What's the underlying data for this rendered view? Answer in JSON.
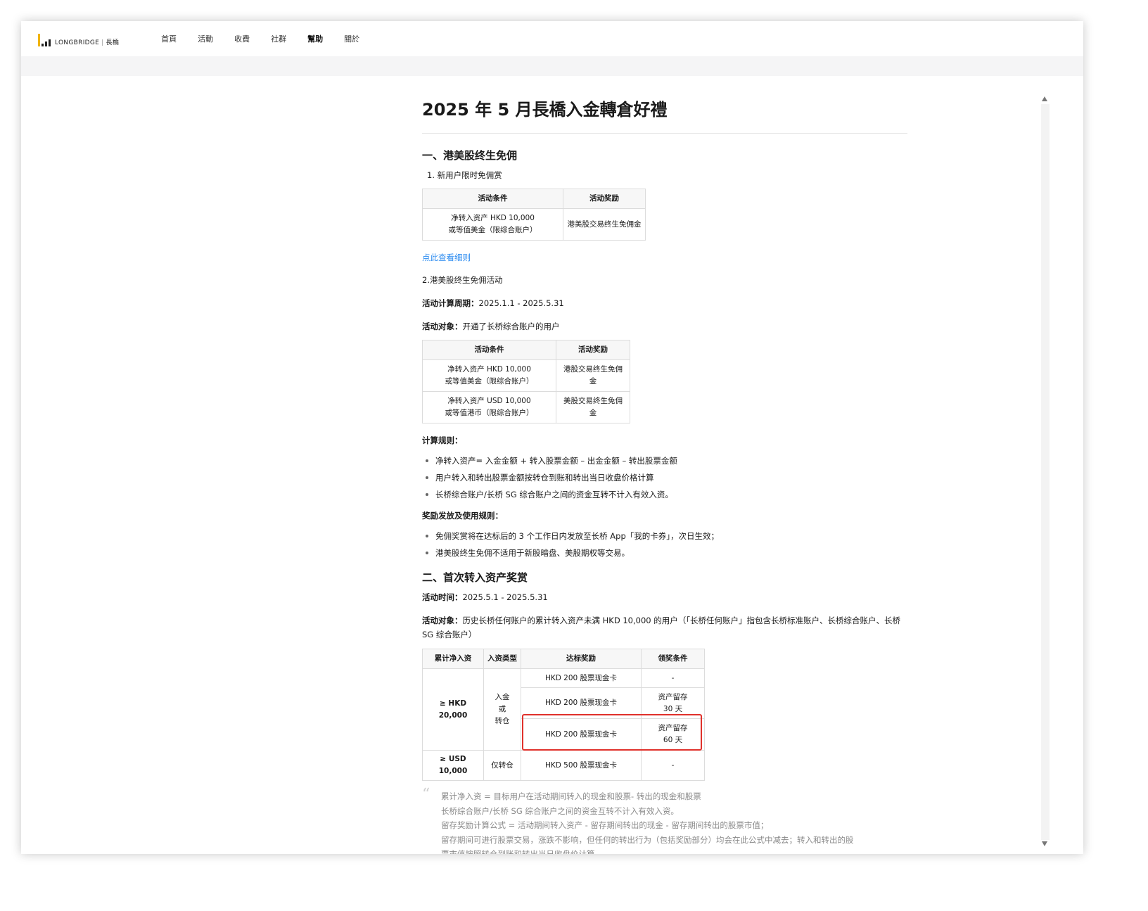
{
  "brand": {
    "name": "LONGBRIDGE",
    "name_cn": "長橋"
  },
  "nav": [
    {
      "label": "首頁",
      "active": false
    },
    {
      "label": "活動",
      "active": false
    },
    {
      "label": "收費",
      "active": false
    },
    {
      "label": "社群",
      "active": false
    },
    {
      "label": "幫助",
      "active": true
    },
    {
      "label": "關於",
      "active": false
    }
  ],
  "article": {
    "title": "2025 年 5 月長橋入金轉倉好禮",
    "s1": {
      "heading": "一、港美股终生免佣",
      "item1": "1. 新用户限时免佣赏",
      "table1": {
        "headers": [
          "活动条件",
          "活动奖励"
        ],
        "row": [
          "净转入资产 HKD 10,000",
          "或等值美金（限综合账户）",
          "港美股交易终生免佣金"
        ]
      },
      "link": "点此查看细则",
      "item2": "2.港美股终生免佣活动",
      "period_label": "活动计算周期：",
      "period_value": "2025.1.1 - 2025.5.31",
      "target_label": "活动对象：",
      "target_value": "开通了长桥综合账户的用户",
      "table2": {
        "headers": [
          "活动条件",
          "活动奖励"
        ],
        "rows": [
          [
            "净转入资产 HKD 10,000",
            "或等值美金（限综合账户）",
            "港股交易终生免佣金"
          ],
          [
            "净转入资产 USD 10,000",
            "或等值港币（限综合账户）",
            "美股交易终生免佣金"
          ]
        ]
      },
      "calc_title": "计算规则：",
      "calc_rules": [
        "净转入资产= 入金金额 + 转入股票金额 – 出金金额 – 转出股票金额",
        "用户转入和转出股票金额按转仓到账和转出当日收盘价格计算",
        "长桥综合账户/长桥 SG 综合账户之间的资金互转不计入有效入资。"
      ],
      "reward_title": "奖励发放及使用规则：",
      "reward_rules": [
        "免佣奖赏将在达标后的 3 个工作日内发放至长桥 App「我的卡券」，次日生效；",
        "港美股终生免佣不适用于新股暗盘、美股期权等交易。"
      ]
    },
    "s2": {
      "heading": "二、首次转入资产奖赏",
      "time_label": "活动时间：",
      "time_value": "2025.5.1 - 2025.5.31",
      "target_label": "活动对象：",
      "target_value": "历史长桥任何账户的累计转入资产未满 HKD 10,000 的用户（「长桥任何账户」指包含长桥标准账户、长桥综合账户、长桥 SG 综合账户）",
      "table": {
        "headers": [
          "累计净入资",
          "入资类型",
          "达标奖励",
          "领奖条件"
        ],
        "g1_amount": "≥ HKD 20,000",
        "g1_type": [
          "入金",
          "或",
          "转仓"
        ],
        "g1_rows": [
          {
            "reward": "HKD 200 股票现金卡",
            "cond": [
              "-"
            ]
          },
          {
            "reward": "HKD 200 股票现金卡",
            "cond": [
              "资产留存",
              "30 天"
            ]
          },
          {
            "reward": "HKD 200 股票现金卡",
            "cond": [
              "资产留存",
              "60 天"
            ]
          }
        ],
        "g2": {
          "amount": "≥ USD 10,000",
          "type": "仅转仓",
          "reward": "HKD 500 股票现金卡",
          "cond": "-"
        }
      },
      "notes": [
        "累计净入资 = 目标用户在活动期间转入的现金和股票- 转出的现金和股票",
        "长桥综合账户/长桥 SG 综合账户之间的资金互转不计入有效入资。",
        "留存奖励计算公式 = 活动期间转入资产 - 留存期间转出的现金 - 留存期间转出的股票市值；",
        "留存期间可进行股票交易，涨跌不影响，但任何的转出行为（包括奖励部分）均会在此公式中减去；转入和转出的股",
        "票市值按照转仓到账和转出当日收盘价计算。"
      ]
    }
  },
  "colors": {
    "link": "#2d8cf0",
    "highlight": "#e0312b",
    "logo_yellow": "#f0b400"
  }
}
